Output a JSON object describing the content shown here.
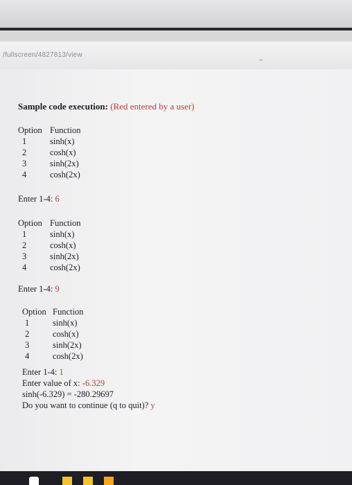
{
  "browser": {
    "url": "/fullscreen/4827813/view"
  },
  "heading": {
    "bold": "Sample code execution:",
    "note": "(Red entered by a user)"
  },
  "menus": [
    {
      "header_opt": "Option",
      "header_fn": "Function",
      "rows": [
        {
          "n": "1",
          "f": "sinh(x)"
        },
        {
          "n": "2",
          "f": "cosh(x)"
        },
        {
          "n": "3",
          "f": "sinh(2x)"
        },
        {
          "n": "4",
          "f": "cosh(2x)"
        }
      ],
      "prompt": "Enter 1-4:",
      "input": "6"
    },
    {
      "header_opt": "Option",
      "header_fn": "Function",
      "rows": [
        {
          "n": "1",
          "f": "sinh(x)"
        },
        {
          "n": "2",
          "f": "cosh(x)"
        },
        {
          "n": "3",
          "f": "sinh(2x)"
        },
        {
          "n": "4",
          "f": "cosh(2x)"
        }
      ],
      "prompt": "Enter 1-4:",
      "input": "9"
    },
    {
      "header_opt": "Option",
      "header_fn": "Function",
      "rows": [
        {
          "n": "1",
          "f": "sinh(x)"
        },
        {
          "n": "2",
          "f": "cosh(x)"
        },
        {
          "n": "3",
          "f": "sinh(2x)"
        },
        {
          "n": "4",
          "f": "cosh(2x)"
        }
      ],
      "prompt": "Enter 1-4:",
      "input": "1"
    }
  ],
  "final": {
    "value_prompt": "Enter value of x:",
    "value_input": "-6.329",
    "result": "sinh(-6.329) = -280.29697",
    "continue_prompt": "Do you want to continue (q to quit)?",
    "continue_input": "y"
  },
  "colors": {
    "user_input": "#c0392b",
    "text": "#1d1d22"
  }
}
